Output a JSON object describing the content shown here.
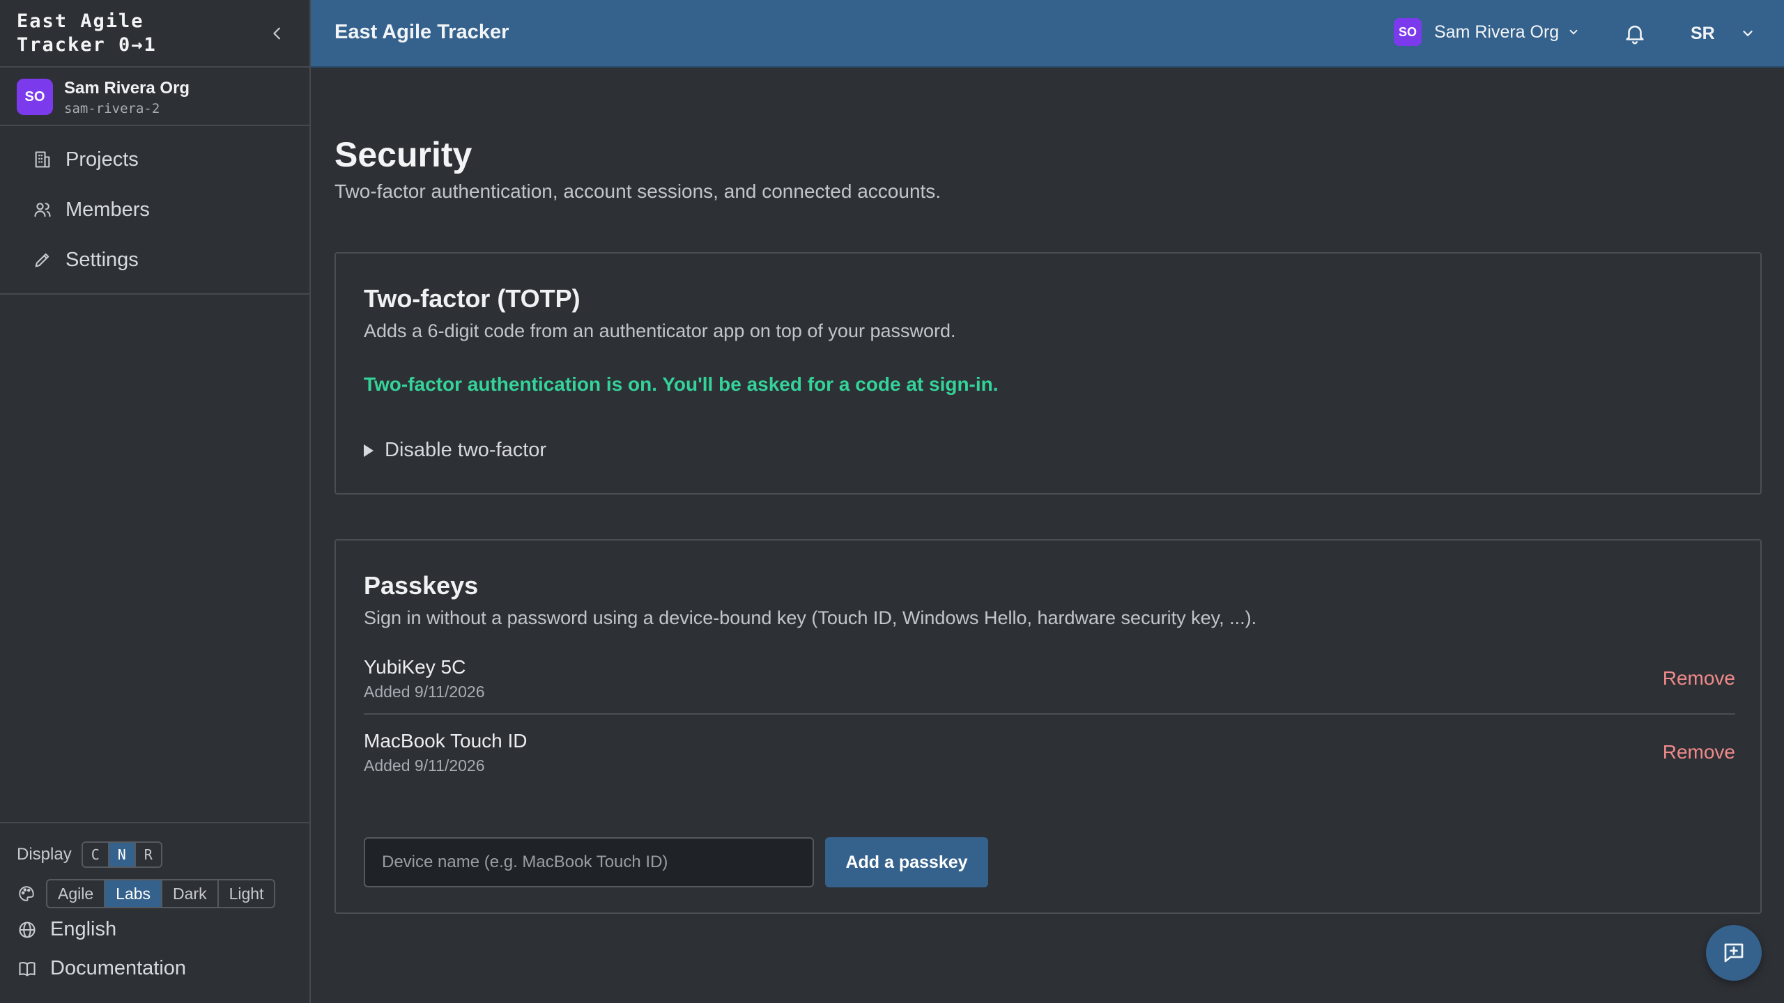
{
  "sidebar": {
    "brand_line1": "East Agile",
    "brand_line2": "Tracker 0→1",
    "org": {
      "initials": "SO",
      "name": "Sam Rivera Org",
      "slug": "sam-rivera-2"
    },
    "nav": [
      {
        "label": "Projects",
        "icon": "building-icon"
      },
      {
        "label": "Members",
        "icon": "users-icon"
      },
      {
        "label": "Settings",
        "icon": "pencil-icon"
      }
    ],
    "display": {
      "label": "Display",
      "options": [
        "C",
        "N",
        "R"
      ],
      "selected": "N"
    },
    "theme": {
      "options": [
        "Agile",
        "Labs",
        "Dark",
        "Light"
      ],
      "selected": "Labs"
    },
    "language": "English",
    "documentation": "Documentation"
  },
  "topbar": {
    "title": "East Agile Tracker",
    "org_initials": "SO",
    "org_name": "Sam Rivera Org",
    "user_initials": "SR"
  },
  "page": {
    "title": "Security",
    "subtitle": "Two-factor authentication, account sessions, and connected accounts."
  },
  "totp": {
    "title": "Two-factor (TOTP)",
    "description": "Adds a 6-digit code from an authenticator app on top of your password.",
    "status": "Two-factor authentication is on. You'll be asked for a code at sign-in.",
    "disable_label": "Disable two-factor"
  },
  "passkeys": {
    "title": "Passkeys",
    "description": "Sign in without a password using a device-bound key (Touch ID, Windows Hello, hardware security key, ...).",
    "items": [
      {
        "name": "YubiKey 5C",
        "added": "Added 9/11/2026",
        "remove_label": "Remove"
      },
      {
        "name": "MacBook Touch ID",
        "added": "Added 9/11/2026",
        "remove_label": "Remove"
      }
    ],
    "input_placeholder": "Device name (e.g. MacBook Touch ID)",
    "input_value": "",
    "add_label": "Add a passkey"
  },
  "colors": {
    "topbar": "#35628c",
    "background": "#2d3035",
    "success": "#34d399",
    "danger": "#f08a8a",
    "org_badge": "#7c3aed"
  }
}
